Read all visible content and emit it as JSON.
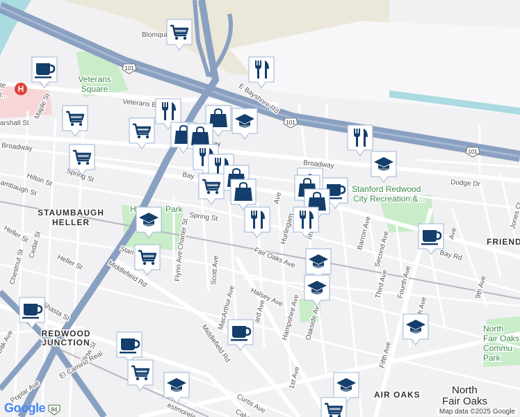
{
  "streets": {
    "blomquist": "Blomquist St",
    "veterans_blvd": "Veterans Blvd",
    "e_bayshore": "E Bayshore Rd",
    "broadway_w": "Broadway",
    "broadway_e": "Broadway",
    "marshall": "arshall St",
    "maple": "Maple St",
    "hilton": "Hilton St",
    "spring_w": "Spring St",
    "spring_e": "Spring St",
    "staumbaugh": "ambaugh St",
    "bay_w": "Bay",
    "bay_rd": "Bay Rd",
    "dodge": "Dodge Dr",
    "heller_st1": "Heller St",
    "heller_st2": "Heller St",
    "cedar": "Cedar St",
    "chestnut": "Chestnut St",
    "charter": "Charter St",
    "flynn": "Flynn Ave",
    "scott": "Scott Ave",
    "stan": "Stan",
    "middlefield_w": "Middlefield Rd",
    "middlefield_s": "Middlefield Rd",
    "fair_oaks": "Fair Oaks Ave",
    "halsey": "Halsey Ave",
    "macarthur": "MacArthur Ave",
    "hurlingame": "Hurlingam",
    "hampshire": "Hampshire Ave",
    "oakside": "Oakside Av",
    "barron": "Barron Ave",
    "second": "Second Ave",
    "third": "Third Ave",
    "fourth": "Fourth Ave",
    "fifth": "Fifth Ave",
    "fifth_n": "th Ave",
    "ninth": "9th Ave",
    "jones": "Jones Ct",
    "first": "1st Ave",
    "shasta": "Shasta St",
    "oak": "Oak Ave",
    "willow": "Willow St",
    "el_camino": "El Camino Real",
    "poplar": "Poplar Ave",
    "curtis": "Curtis Ave",
    "calvin": "Calvin",
    "westmoreland": "estmorela",
    "way": "way",
    "ard_ave": "ard Ave",
    "ave_bay": "Ave",
    "rington": "rington Av",
    "ave_h": "Ave"
  },
  "shields": {
    "us101_a": "101",
    "us101_b": "101",
    "us101_c": "101",
    "ca84": "84"
  },
  "places": {
    "veterans_square": [
      "Veterans",
      "Square"
    ],
    "staumbaugh_heller": [
      "STAUMBAUGH",
      "HELLER"
    ],
    "redwood_junction": [
      "REDWOOD",
      "JUNCTION"
    ],
    "hoover_park": "H",
    "hoover_park2": "Park",
    "stanford_rec": [
      "Stanford Redwood",
      "City Recreation &..."
    ],
    "north_fair_oaks_park": [
      "North",
      "Fair Oaks",
      "Commu",
      "Park"
    ],
    "friend": "FRIEND",
    "fair_oaks_area": "AIR OAKS",
    "north_fair_oaks": [
      "North",
      "Fair Oaks"
    ],
    "hospital_frag": [
      "te",
      "l..."
    ]
  },
  "hospital_icon": "H",
  "attribution": "Map data ©2025 Google",
  "logo": "Google",
  "colors": {
    "freeway": "#8aa0c1",
    "road_major": "#ffffff",
    "park": "#c9ecc9",
    "industrial": "#ebe7d9",
    "water": "#a9dbe0",
    "hospital": "#f6d6d6",
    "pin_glyph": "#143e6b"
  },
  "pins": [
    {
      "id": "pin-shopping-cart-1",
      "icon": "shopping-cart"
    },
    {
      "id": "pin-coffee-1",
      "icon": "coffee"
    },
    {
      "id": "pin-restaurant-1",
      "icon": "restaurant"
    },
    {
      "id": "pin-shopping-cart-2",
      "icon": "shopping-cart"
    },
    {
      "id": "pin-restaurant-2",
      "icon": "restaurant"
    },
    {
      "id": "pin-shopping-cart-3",
      "icon": "shopping-cart"
    },
    {
      "id": "pin-shopping-bag-1",
      "icon": "shopping-bag"
    },
    {
      "id": "pin-shopping-bag-2",
      "icon": "shopping-bag"
    },
    {
      "id": "pin-shopping-bag-3",
      "icon": "shopping-bag"
    },
    {
      "id": "pin-education-1",
      "icon": "education"
    },
    {
      "id": "pin-restaurant-3",
      "icon": "restaurant"
    },
    {
      "id": "pin-education-2",
      "icon": "education"
    },
    {
      "id": "pin-shopping-cart-4",
      "icon": "shopping-cart"
    },
    {
      "id": "pin-restaurant-4",
      "icon": "restaurant"
    },
    {
      "id": "pin-restaurant-5",
      "icon": "restaurant"
    },
    {
      "id": "pin-shopping-bag-4",
      "icon": "shopping-bag"
    },
    {
      "id": "pin-shopping-cart-5",
      "icon": "shopping-cart"
    },
    {
      "id": "pin-shopping-bag-5",
      "icon": "shopping-bag"
    },
    {
      "id": "pin-education-3",
      "icon": "education"
    },
    {
      "id": "pin-restaurant-6",
      "icon": "restaurant"
    },
    {
      "id": "pin-shopping-bag-6",
      "icon": "shopping-bag"
    },
    {
      "id": "pin-coffee-2",
      "icon": "coffee"
    },
    {
      "id": "pin-shopping-bag-7",
      "icon": "shopping-bag"
    },
    {
      "id": "pin-restaurant-7",
      "icon": "restaurant"
    },
    {
      "id": "pin-coffee-3",
      "icon": "coffee"
    },
    {
      "id": "pin-shopping-cart-6",
      "icon": "shopping-cart"
    },
    {
      "id": "pin-education-4",
      "icon": "education"
    },
    {
      "id": "pin-education-5",
      "icon": "education"
    },
    {
      "id": "pin-coffee-4",
      "icon": "coffee"
    },
    {
      "id": "pin-coffee-5",
      "icon": "coffee"
    },
    {
      "id": "pin-education-6",
      "icon": "education"
    },
    {
      "id": "pin-coffee-6",
      "icon": "coffee"
    },
    {
      "id": "pin-shopping-cart-7",
      "icon": "shopping-cart"
    },
    {
      "id": "pin-education-7",
      "icon": "education"
    },
    {
      "id": "pin-education-8",
      "icon": "education"
    },
    {
      "id": "pin-education-9",
      "icon": "education"
    },
    {
      "id": "pin-shopping-cart-8",
      "icon": "shopping-cart"
    }
  ]
}
